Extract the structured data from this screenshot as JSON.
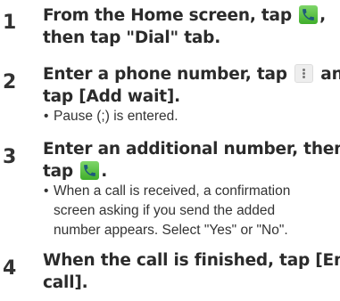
{
  "steps": [
    {
      "number": "1",
      "title_lines": [
        {
          "before": "From the Home screen, tap ",
          "after": ","
        },
        {
          "text": "then tap \"Dial\" tab."
        }
      ]
    },
    {
      "number": "2",
      "title_lines": [
        {
          "before": "Enter a phone number, tap ",
          "after": " and"
        },
        {
          "text": "tap [Add wait]."
        }
      ],
      "notes": [
        "Pause (;) is entered."
      ]
    },
    {
      "number": "3",
      "title_lines": [
        {
          "text": "Enter an additional number, then"
        },
        {
          "before": "tap ",
          "after": "."
        }
      ],
      "notes_lines": [
        "When a call is received, a confirmation",
        "screen asking if you send the added",
        "number appears. Select \"Yes\" or \"No\"."
      ]
    },
    {
      "number": "4",
      "title_lines": [
        {
          "text": "When the call is finished, tap [End"
        },
        {
          "text": "call]."
        }
      ]
    }
  ],
  "bullet": "•",
  "icons": {
    "phone": "phone-icon",
    "menu": "menu-icon",
    "phone_color": "#4cbf35"
  }
}
